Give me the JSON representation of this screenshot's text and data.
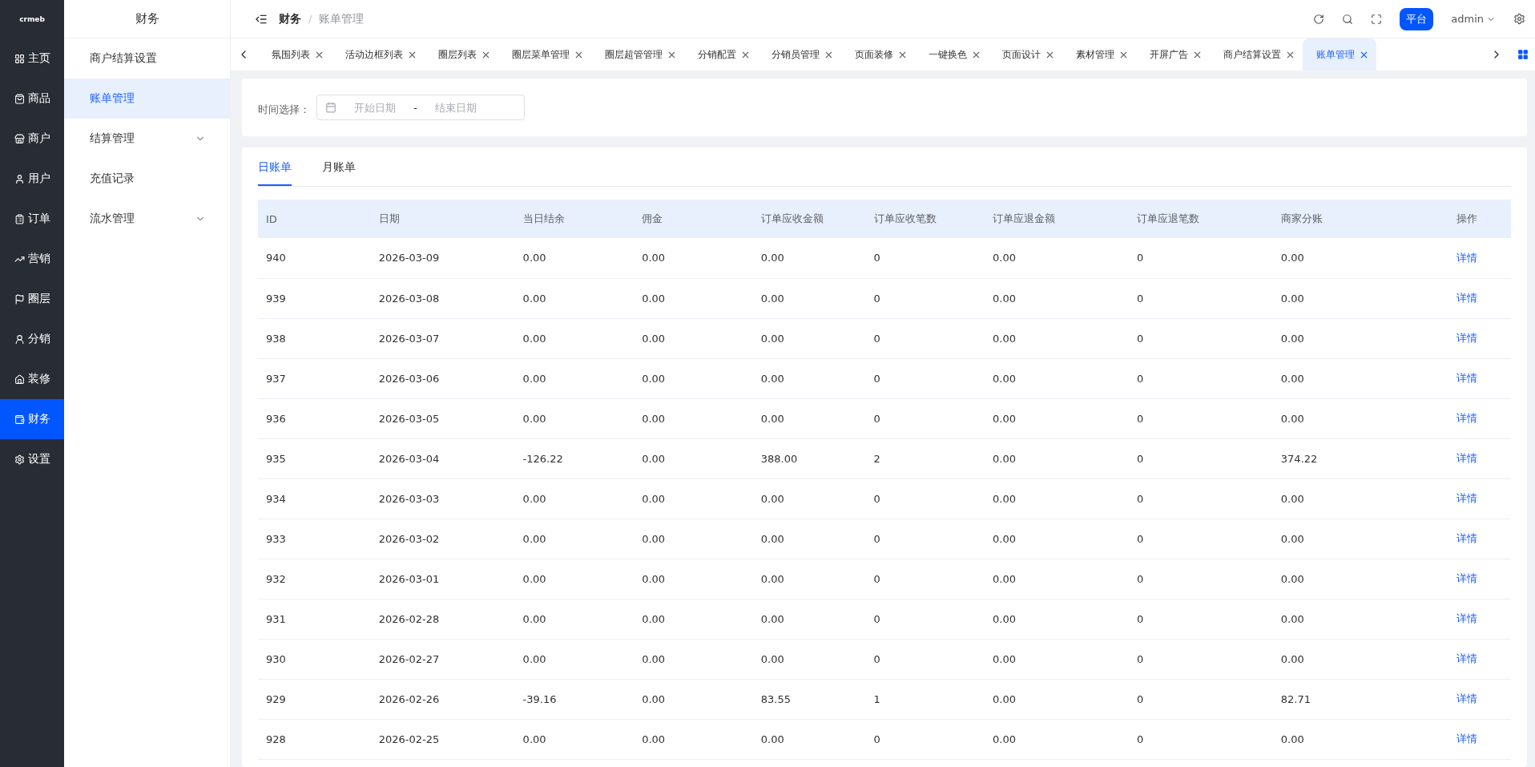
{
  "logo": {
    "text": "crmeb"
  },
  "rail": [
    {
      "label": "主页",
      "selected": false
    },
    {
      "label": "商品",
      "selected": false
    },
    {
      "label": "商户",
      "selected": false
    },
    {
      "label": "用户",
      "selected": false
    },
    {
      "label": "订单",
      "selected": false
    },
    {
      "label": "营销",
      "selected": false
    },
    {
      "label": "圈层",
      "selected": false
    },
    {
      "label": "分销",
      "selected": false
    },
    {
      "label": "装修",
      "selected": false
    },
    {
      "label": "财务",
      "selected": true
    },
    {
      "label": "设置",
      "selected": false
    }
  ],
  "submenu": {
    "title": "财务",
    "items": [
      {
        "label": "商户结算设置",
        "selected": false,
        "expandable": false
      },
      {
        "label": "账单管理",
        "selected": true,
        "expandable": false
      },
      {
        "label": "结算管理",
        "selected": false,
        "expandable": true
      },
      {
        "label": "充值记录",
        "selected": false,
        "expandable": false
      },
      {
        "label": "流水管理",
        "selected": false,
        "expandable": true
      }
    ]
  },
  "breadcrumb": {
    "items": [
      "财务",
      "账单管理"
    ],
    "separator": "/"
  },
  "header": {
    "platform_button": "平台",
    "user": "admin"
  },
  "page_tabs": [
    {
      "label": "氛围列表",
      "selected": false
    },
    {
      "label": "活动边框列表",
      "selected": false
    },
    {
      "label": "圈层列表",
      "selected": false
    },
    {
      "label": "圈层菜单管理",
      "selected": false
    },
    {
      "label": "圈层超管管理",
      "selected": false
    },
    {
      "label": "分销配置",
      "selected": false
    },
    {
      "label": "分销员管理",
      "selected": false
    },
    {
      "label": "页面装修",
      "selected": false
    },
    {
      "label": "一键换色",
      "selected": false
    },
    {
      "label": "页面设计",
      "selected": false
    },
    {
      "label": "素材管理",
      "selected": false
    },
    {
      "label": "开屏广告",
      "selected": false
    },
    {
      "label": "商户结算设置",
      "selected": false
    },
    {
      "label": "账单管理",
      "selected": true
    }
  ],
  "filter": {
    "label": "时间选择：",
    "start_placeholder": "开始日期",
    "separator": "-",
    "end_placeholder": "结束日期"
  },
  "bill_tabs": [
    {
      "label": "日账单",
      "selected": true
    },
    {
      "label": "月账单",
      "selected": false
    }
  ],
  "table": {
    "columns": [
      "ID",
      "日期",
      "当日结余",
      "佣金",
      "订单应收金额",
      "订单应收笔数",
      "订单应退金额",
      "订单应退笔数",
      "商家分账",
      "操作"
    ],
    "rows": [
      [
        "940",
        "2026-03-09",
        "0.00",
        "0.00",
        "0.00",
        "0",
        "0.00",
        "0",
        "0.00",
        "详情"
      ],
      [
        "939",
        "2026-03-08",
        "0.00",
        "0.00",
        "0.00",
        "0",
        "0.00",
        "0",
        "0.00",
        "详情"
      ],
      [
        "938",
        "2026-03-07",
        "0.00",
        "0.00",
        "0.00",
        "0",
        "0.00",
        "0",
        "0.00",
        "详情"
      ],
      [
        "937",
        "2026-03-06",
        "0.00",
        "0.00",
        "0.00",
        "0",
        "0.00",
        "0",
        "0.00",
        "详情"
      ],
      [
        "936",
        "2026-03-05",
        "0.00",
        "0.00",
        "0.00",
        "0",
        "0.00",
        "0",
        "0.00",
        "详情"
      ],
      [
        "935",
        "2026-03-04",
        "-126.22",
        "0.00",
        "388.00",
        "2",
        "0.00",
        "0",
        "374.22",
        "详情"
      ],
      [
        "934",
        "2026-03-03",
        "0.00",
        "0.00",
        "0.00",
        "0",
        "0.00",
        "0",
        "0.00",
        "详情"
      ],
      [
        "933",
        "2026-03-02",
        "0.00",
        "0.00",
        "0.00",
        "0",
        "0.00",
        "0",
        "0.00",
        "详情"
      ],
      [
        "932",
        "2026-03-01",
        "0.00",
        "0.00",
        "0.00",
        "0",
        "0.00",
        "0",
        "0.00",
        "详情"
      ],
      [
        "931",
        "2026-02-28",
        "0.00",
        "0.00",
        "0.00",
        "0",
        "0.00",
        "0",
        "0.00",
        "详情"
      ],
      [
        "930",
        "2026-02-27",
        "0.00",
        "0.00",
        "0.00",
        "0",
        "0.00",
        "0",
        "0.00",
        "详情"
      ],
      [
        "929",
        "2026-02-26",
        "-39.16",
        "0.00",
        "83.55",
        "1",
        "0.00",
        "0",
        "82.71",
        "详情"
      ],
      [
        "928",
        "2026-02-25",
        "0.00",
        "0.00",
        "0.00",
        "0",
        "0.00",
        "0",
        "0.00",
        "详情"
      ]
    ]
  }
}
